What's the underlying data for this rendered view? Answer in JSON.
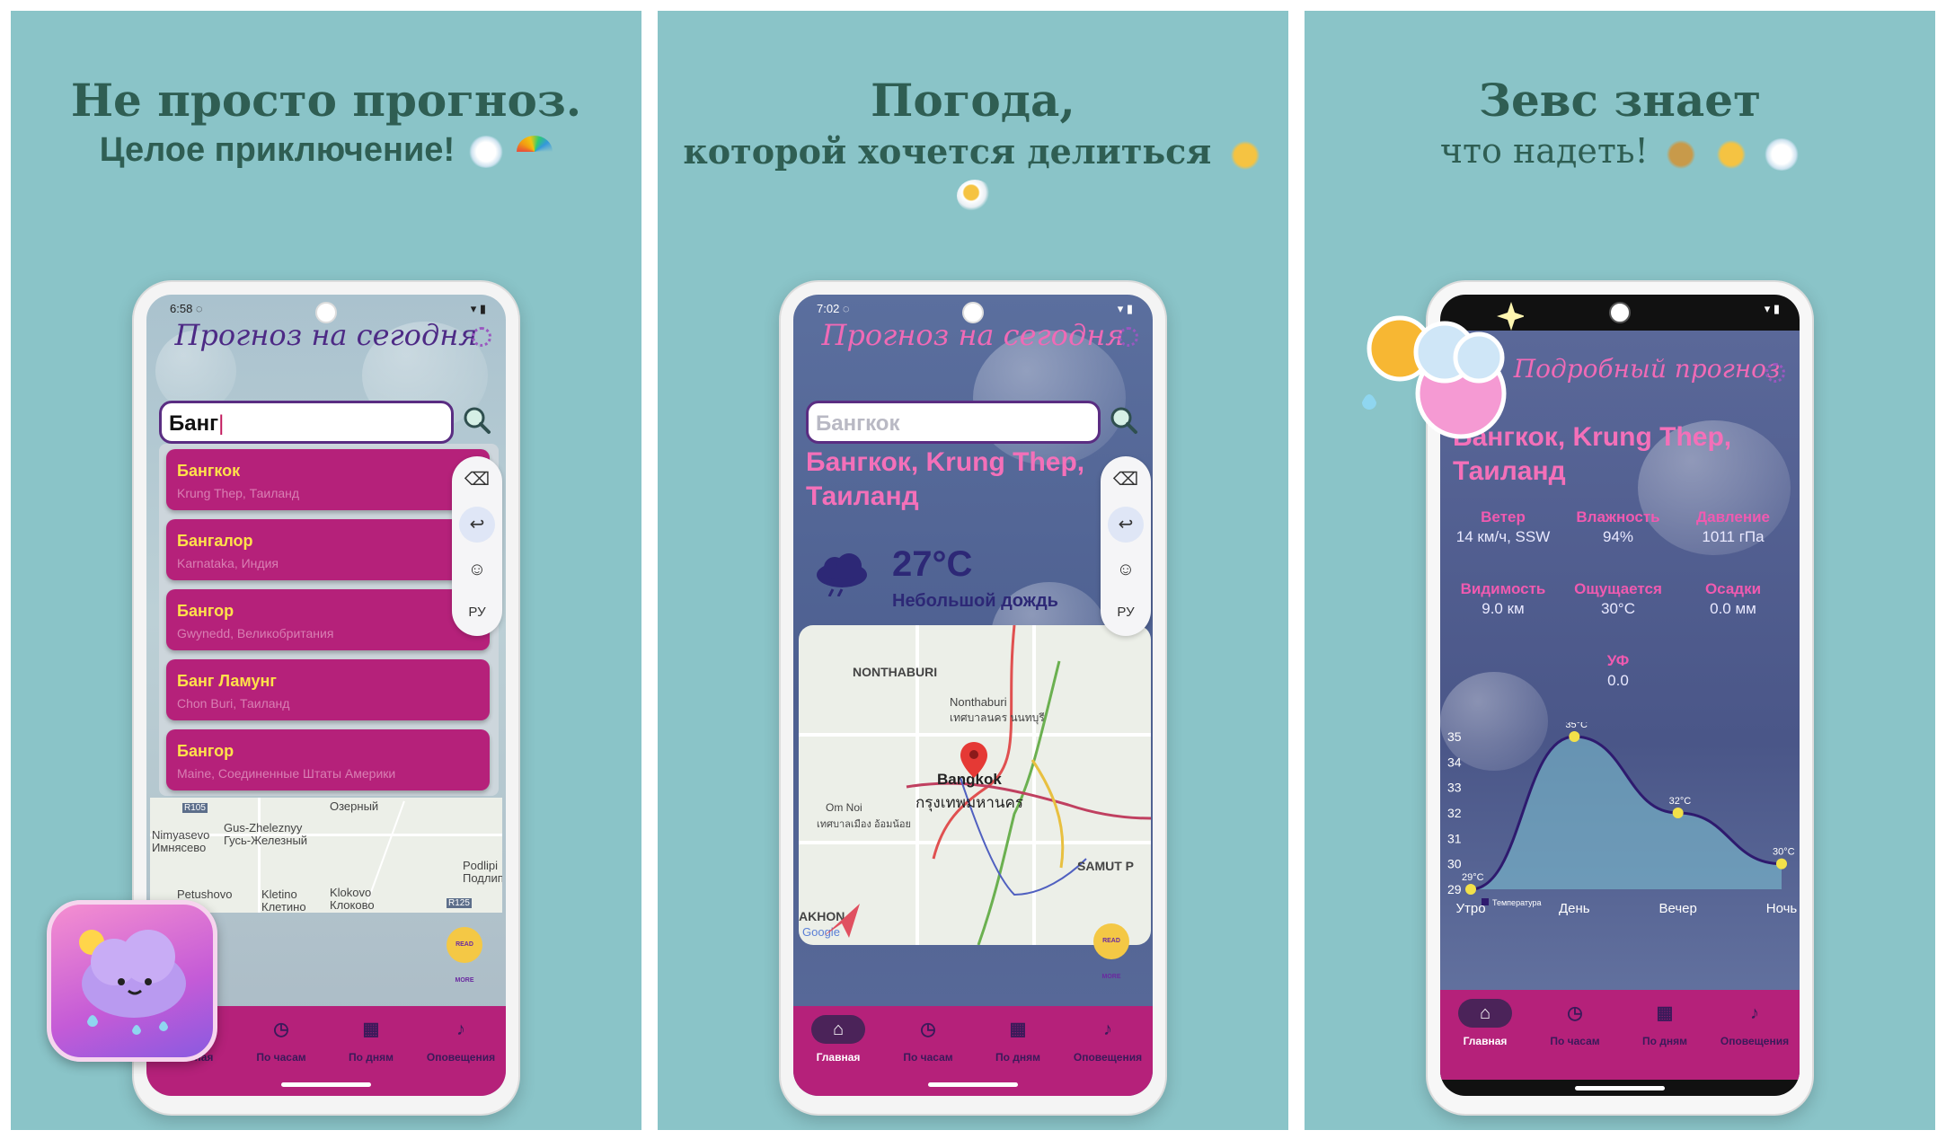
{
  "panels": [
    {
      "heading": "Не просто прогноз.",
      "subheading": "Целое приключение!",
      "emoji_icons": [
        "rain-cloud-icon",
        "rainbow-icon"
      ],
      "phone": {
        "status_time": "6:58",
        "app_title": "Прогноз на сегодня",
        "search_value": "Банг",
        "suggestions": [
          {
            "name": "Бангкок",
            "region": "Krung Thep, Таиланд"
          },
          {
            "name": "Бангалор",
            "region": "Karnataka, Индия"
          },
          {
            "name": "Бангор",
            "region": "Gwynedd, Великобритания"
          },
          {
            "name": "Банг Ламунг",
            "region": "Chon Buri, Таиланд"
          },
          {
            "name": "Бангор",
            "region": "Maine, Соединенные Штаты Америки"
          }
        ],
        "keyboard_actions": [
          "⌫",
          "↩",
          "☺",
          "РУ"
        ],
        "map_labels": [
          "Озерный",
          "Gus-Zheleznyy",
          "Гусь-Железный",
          "Nimyasevo",
          "Имнясево",
          "Klokovo",
          "Клоково",
          "Kletino",
          "Клетино",
          "Podlipi",
          "Подлипи",
          "Petushovo",
          "R105",
          "R125"
        ],
        "readmore": "READ MORE",
        "nav": [
          "Главная",
          "По часам",
          "По дням",
          "Оповещения"
        ]
      }
    },
    {
      "heading": "Погода,",
      "subheading": "которой хочется делиться",
      "emoji_icons": [
        "handshake-icon",
        "sun-behind-cloud-icon"
      ],
      "phone": {
        "status_time": "7:02",
        "app_title": "Прогноз на сегодня",
        "search_placeholder": "Бангкок",
        "city": "Бангкок, Krung Thep, Таиланд",
        "temperature": "27°C",
        "description": "Небольшой дождь",
        "keyboard_actions": [
          "⌫",
          "↩",
          "☺",
          "РУ"
        ],
        "map_labels": [
          "NONTHABURI",
          "Nonthaburi",
          "เทศบาลนคร นนทบุรี",
          "Bangkok",
          "กรุงเทพมหานคร",
          "Om Noi",
          "เทศบาลเมือง อ้อมน้อย",
          "SAMUT P",
          "AKHON",
          "Google"
        ],
        "readmore": "READ MORE",
        "nav": [
          "Главная",
          "По часам",
          "По дням",
          "Оповещения"
        ]
      }
    },
    {
      "heading": "Зевс знает",
      "subheading": "что надеть!",
      "emoji_icons": [
        "coat-icon",
        "sun-icon",
        "rain-cloud-icon"
      ],
      "phone": {
        "app_title": "Подробный прогноз",
        "city": "Бангкок, Krung Thep, Таиланд",
        "details": [
          {
            "label": "Ветер",
            "value": "14 км/ч, SSW"
          },
          {
            "label": "Влажность",
            "value": "94%"
          },
          {
            "label": "Давление",
            "value": "1011 гПа"
          },
          {
            "label": "Видимость",
            "value": "9.0 км"
          },
          {
            "label": "Ощущается",
            "value": "30°C"
          },
          {
            "label": "Осадки",
            "value": "0.0 мм"
          },
          {
            "label": "УФ",
            "value": "0.0"
          }
        ],
        "nav": [
          "Главная",
          "По часам",
          "По дням",
          "Оповещения"
        ]
      }
    }
  ],
  "chart_data": {
    "type": "line",
    "categories": [
      "Утро",
      "День",
      "Вечер",
      "Ночь"
    ],
    "series": [
      {
        "name": "Температура",
        "values": [
          29,
          35,
          32,
          30
        ]
      }
    ],
    "data_labels": [
      "29°C",
      "35°C",
      "32°C",
      "30°C"
    ],
    "y_ticks": [
      29,
      30,
      31,
      32,
      33,
      34,
      35
    ],
    "ylim": [
      29,
      35
    ],
    "legend": "Температура",
    "colors": {
      "line": "#2e1a6e",
      "fill": "#7fc6d6",
      "point": "#f2e14a"
    }
  },
  "colors": {
    "panel_bg": "#8ac4c8",
    "heading": "#2f5e53",
    "accent_magenta": "#b5217a",
    "accent_pink": "#f470b9",
    "accent_yellow": "#ffe14a"
  }
}
